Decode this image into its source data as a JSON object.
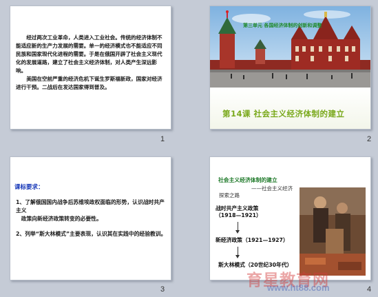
{
  "slides": [
    {
      "number": "1",
      "paragraphs": [
        "经过两次工业革命，人类进入工业社会。传统的经济体制不能适应新的生产力发展的需要。单一的经济模式也不能适应不同民族和国家现代化进程的需要。于是在俄国开辟了社会主义现代化的发展道路，建立了社会主义经济体制，对人类产生深远影响。",
        "美国在空前严重的经济危机下诞生罗斯福新政，国家对经济进行干预。二战后在发达国家得到普及。"
      ]
    },
    {
      "number": "2",
      "unit_title": "第三单元  各国经济体制的创新和调整",
      "lesson_title": "第14课    社会主义经济体制的建立"
    },
    {
      "number": "3",
      "heading": "课标要求：",
      "items": [
        "1、了解俄国国内战争后苏维埃政权面临的形势，认识战时共产主义",
        "政策向新经济政策转变的必要性。",
        "2、列举“斯大林模式”主要表现，认识其在实践中的经验教训。"
      ]
    },
    {
      "number": "4",
      "title": "社会主义经济体制的建立",
      "subtitle": "——社会主义经济",
      "explore": "探索之路",
      "stages": [
        "战时共产主义政策（1918—1921）",
        "新经济政策（1921—1927）",
        "斯大林模式（20世纪30年代）"
      ]
    }
  ],
  "watermark": {
    "text": "育星教育网",
    "url": "www.ht88.com"
  },
  "colors": {
    "background": "#c5cbd6",
    "green_title": "#7aa91c",
    "blue_heading": "#1637b8"
  }
}
